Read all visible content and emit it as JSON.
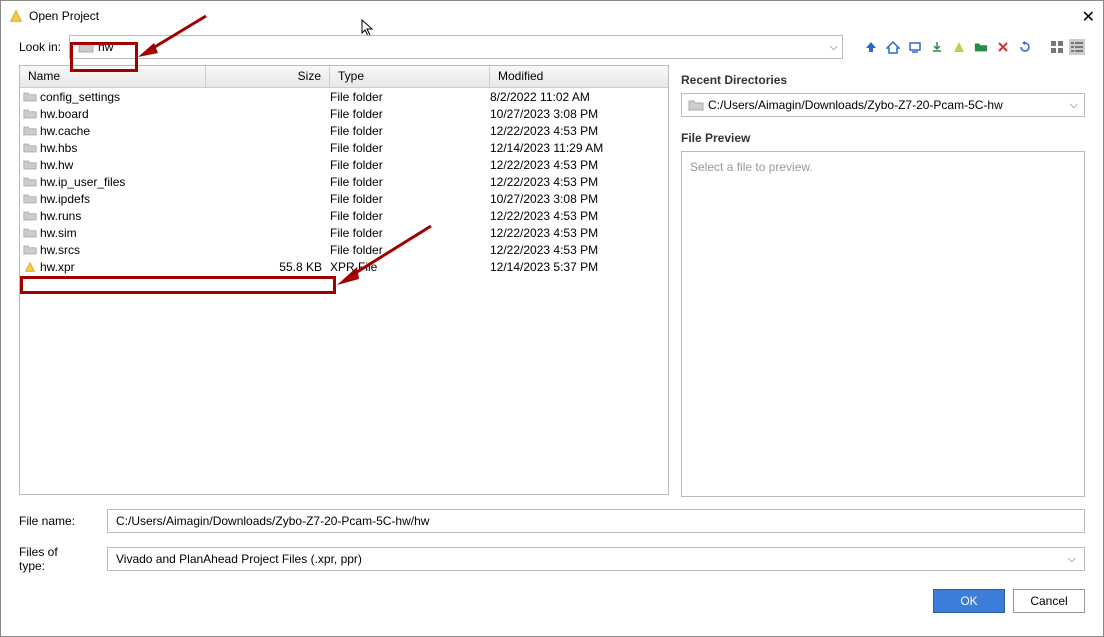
{
  "title": "Open Project",
  "lookin": {
    "label": "Look in:",
    "folder_name": "hw"
  },
  "columns": {
    "name": "Name",
    "size": "Size",
    "type": "Type",
    "modified": "Modified"
  },
  "files": [
    {
      "icon": "folder",
      "name": "config_settings",
      "size": "",
      "type": "File folder",
      "modified": "8/2/2022 11:02 AM"
    },
    {
      "icon": "folder",
      "name": "hw.board",
      "size": "",
      "type": "File folder",
      "modified": "10/27/2023 3:08 PM"
    },
    {
      "icon": "folder",
      "name": "hw.cache",
      "size": "",
      "type": "File folder",
      "modified": "12/22/2023 4:53 PM"
    },
    {
      "icon": "folder",
      "name": "hw.hbs",
      "size": "",
      "type": "File folder",
      "modified": "12/14/2023 11:29 AM"
    },
    {
      "icon": "folder",
      "name": "hw.hw",
      "size": "",
      "type": "File folder",
      "modified": "12/22/2023 4:53 PM"
    },
    {
      "icon": "folder",
      "name": "hw.ip_user_files",
      "size": "",
      "type": "File folder",
      "modified": "12/22/2023 4:53 PM"
    },
    {
      "icon": "folder",
      "name": "hw.ipdefs",
      "size": "",
      "type": "File folder",
      "modified": "10/27/2023 3:08 PM"
    },
    {
      "icon": "folder",
      "name": "hw.runs",
      "size": "",
      "type": "File folder",
      "modified": "12/22/2023 4:53 PM"
    },
    {
      "icon": "folder",
      "name": "hw.sim",
      "size": "",
      "type": "File folder",
      "modified": "12/22/2023 4:53 PM"
    },
    {
      "icon": "folder",
      "name": "hw.srcs",
      "size": "",
      "type": "File folder",
      "modified": "12/22/2023 4:53 PM"
    },
    {
      "icon": "xpr",
      "name": "hw.xpr",
      "size": "55.8 KB",
      "type": "XPR File",
      "modified": "12/14/2023 5:37 PM"
    }
  ],
  "sidebar": {
    "recent_label": "Recent Directories",
    "recent_path": "C:/Users/Aimagin/Downloads/Zybo-Z7-20-Pcam-5C-hw",
    "preview_label": "File Preview",
    "preview_placeholder": "Select a file to preview."
  },
  "filename": {
    "label": "File name:",
    "value": "C:/Users/Aimagin/Downloads/Zybo-Z7-20-Pcam-5C-hw/hw"
  },
  "filetype": {
    "label": "Files of type:",
    "value": "Vivado and PlanAhead Project Files (.xpr, ppr)"
  },
  "buttons": {
    "ok": "OK",
    "cancel": "Cancel"
  }
}
